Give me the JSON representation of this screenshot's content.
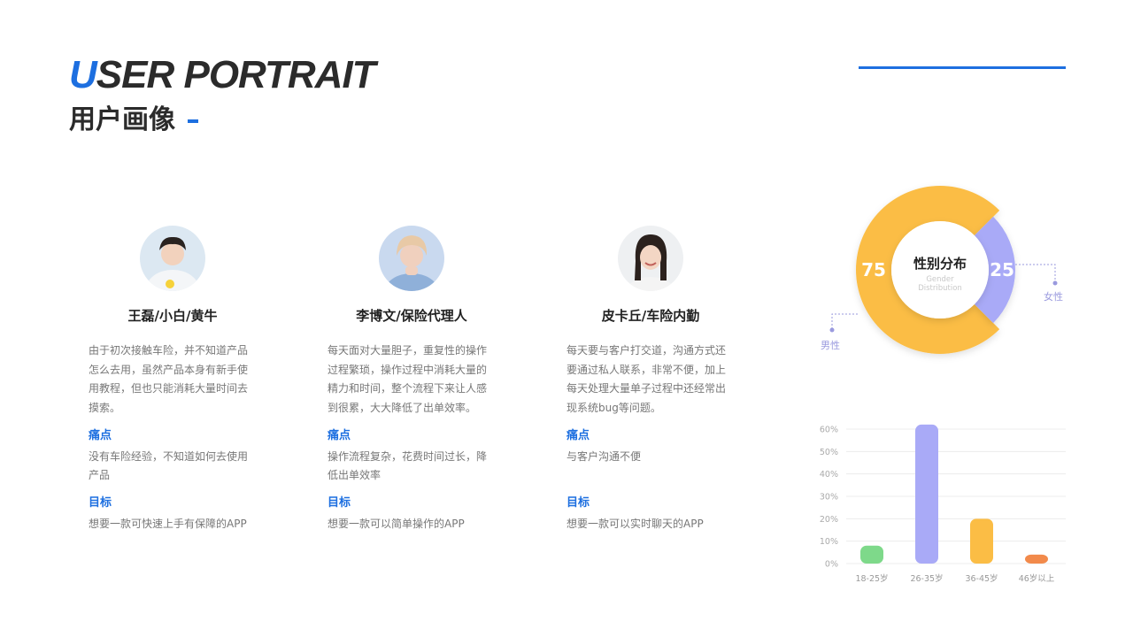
{
  "header": {
    "title_en_first": "U",
    "title_en_rest": "SER PORTRAIT",
    "title_cn": "用户画像"
  },
  "colors": {
    "accent": "#1d6fe0",
    "yellow": "#fbbd45",
    "purple": "#a9aaf7",
    "green": "#7ed98a",
    "orange": "#f28a4b"
  },
  "personas": [
    {
      "name": "王磊/小白/黄牛",
      "desc": "由于初次接触车险，并不知道产品怎么去用，虽然产品本身有新手使用教程，但也只能消耗大量时间去摸索。",
      "pain_label": "痛点",
      "pain": "没有车险经验，不知道如何去使用产品",
      "goal_label": "目标",
      "goal": "想要一款可快速上手有保障的APP"
    },
    {
      "name": "李博文/保险代理人",
      "desc": "每天面对大量胆子，重复性的操作过程繁琐，操作过程中消耗大量的精力和时间，整个流程下来让人感到很累，大大降低了出单效率。",
      "pain_label": "痛点",
      "pain": "操作流程复杂，花费时间过长，降低出单效率",
      "goal_label": "目标",
      "goal": "想要一款可以简单操作的APP"
    },
    {
      "name": "皮卡丘/车险内勤",
      "desc": "每天要与客户打交道，沟通方式还要通过私人联系，非常不便，加上每天处理大量单子过程中还经常出现系统bug等问题。",
      "pain_label": "痛点",
      "pain": "与客户沟通不便",
      "goal_label": "目标",
      "goal": "想要一款可以实时聊天的APP"
    }
  ],
  "chart_data": [
    {
      "type": "pie",
      "title": "性别分布",
      "subtitle": "Gender Distribution",
      "categories": [
        "男性",
        "女性"
      ],
      "values": [
        75,
        25
      ],
      "colors": [
        "#fbbd45",
        "#a9aaf7"
      ]
    },
    {
      "type": "bar",
      "categories": [
        "18-25岁",
        "26-35岁",
        "36-45岁",
        "46岁以上"
      ],
      "values": [
        8,
        62,
        20,
        4
      ],
      "colors": [
        "#7ed98a",
        "#a9aaf7",
        "#fbbd45",
        "#f28a4b"
      ],
      "yticks": [
        "0%",
        "10%",
        "20%",
        "30%",
        "40%",
        "50%",
        "60%"
      ],
      "ylim": [
        0,
        60
      ],
      "grid": true
    }
  ]
}
